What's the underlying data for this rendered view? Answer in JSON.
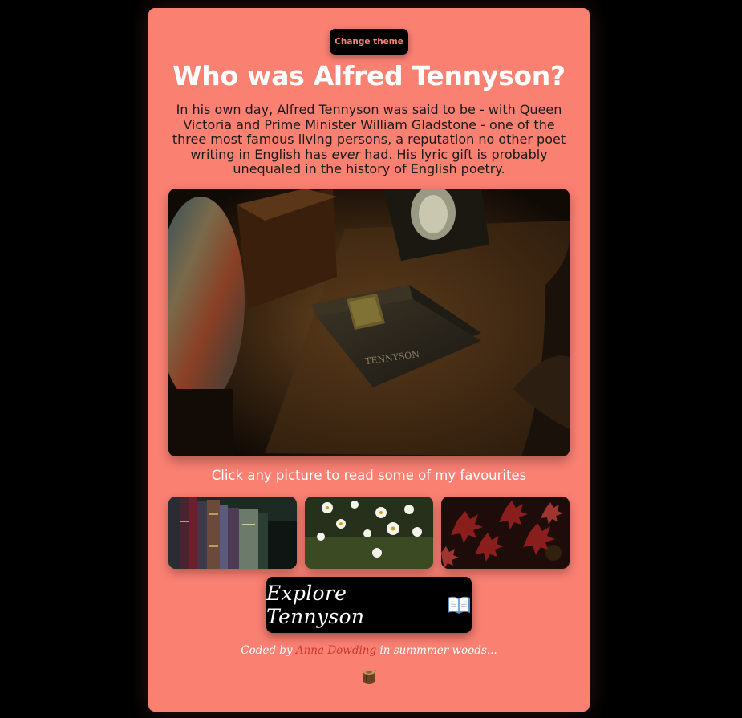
{
  "header": {
    "theme_button_label": "Change theme",
    "title": "Who was Alfred Tennyson?"
  },
  "intro": {
    "before": "In his own day, Alfred Tennyson was said to be - with Queen Victoria and Prime Minister William Gladstone - one of the three most famous living persons, a reputation no other poet writing in English has ",
    "emphasis": "ever",
    "after": " had. His lyric gift is probably unequaled in the history of English poetry."
  },
  "gallery": {
    "hero_book_spine": "TENNYSON",
    "hint": "Click any picture to read some of my favourites",
    "thumbnails": [
      "old-books",
      "white-daisies",
      "red-maple-leaves"
    ]
  },
  "explore": {
    "label": "Explore Tennyson",
    "icon": "open-book-icon"
  },
  "footer": {
    "prefix": "Coded by",
    "author": "Anna Dowding",
    "suffix": "in summmer woods...",
    "icon": "tree-stump-icon"
  },
  "colors": {
    "background": "#000000",
    "card": "#fa8072",
    "accent_text": "#c83a2e"
  }
}
